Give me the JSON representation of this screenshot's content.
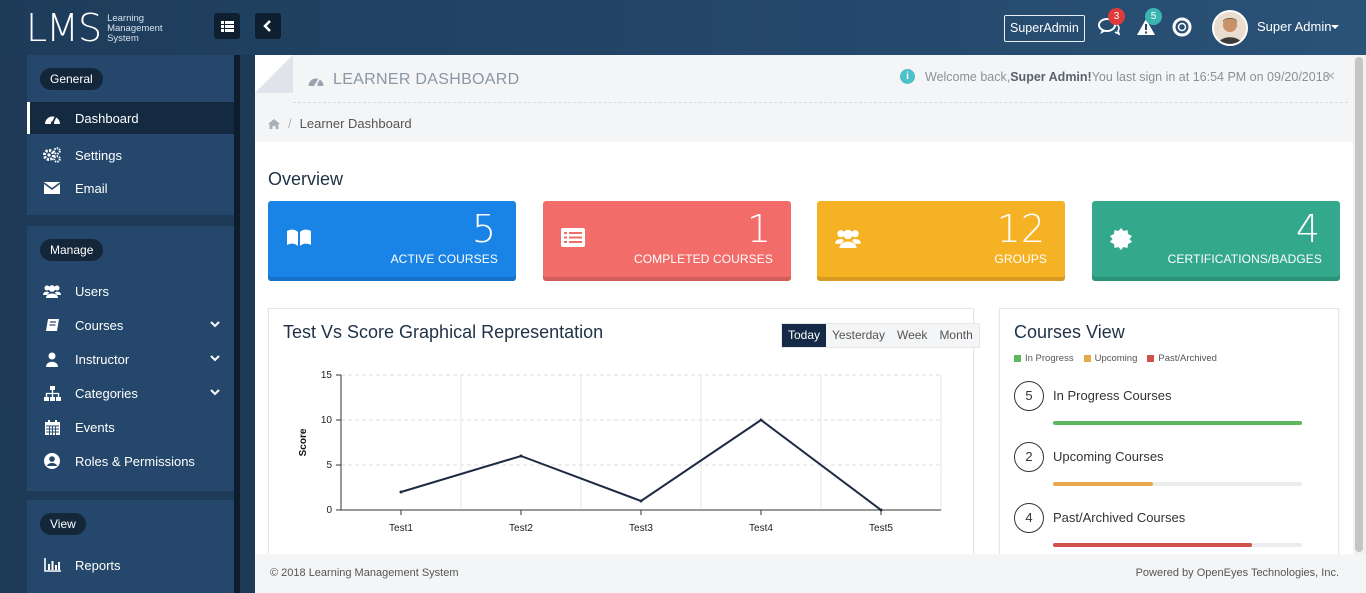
{
  "brand": {
    "logo": "LMS",
    "subtitle": [
      "Learning",
      "Management",
      "System"
    ]
  },
  "topbar": {
    "role": "SuperAdmin",
    "messages_count": "3",
    "alerts_count": "5",
    "user_name": "Super Admin",
    "icons": [
      "menu-icon",
      "chevron-left-icon",
      "chat-icon",
      "warning-icon",
      "lifebuoy-icon"
    ]
  },
  "sidebar": {
    "groups": [
      {
        "label": "General",
        "items": [
          {
            "label": "Dashboard",
            "icon": "dashboard-icon",
            "active": true
          },
          {
            "label": "Settings",
            "icon": "cogs-icon"
          },
          {
            "label": "Email",
            "icon": "envelope-icon"
          }
        ]
      },
      {
        "label": "Manage",
        "items": [
          {
            "label": "Users",
            "icon": "users-icon"
          },
          {
            "label": "Courses",
            "icon": "book-icon",
            "expandable": true
          },
          {
            "label": "Instructor",
            "icon": "user-icon",
            "expandable": true
          },
          {
            "label": "Categories",
            "icon": "sitemap-icon",
            "expandable": true
          },
          {
            "label": "Events",
            "icon": "calendar-icon"
          },
          {
            "label": "Roles & Permissions",
            "icon": "user-circle-icon"
          }
        ]
      },
      {
        "label": "View",
        "items": [
          {
            "label": "Reports",
            "icon": "bar-chart-icon"
          }
        ]
      }
    ]
  },
  "header": {
    "title": "LEARNER DASHBOARD",
    "welcome_prefix": "Welcome back,",
    "welcome_user": "Super Admin!",
    "welcome_suffix": "You last sign in at 16:54 PM on 09/20/2018",
    "close": "×"
  },
  "breadcrumb": {
    "sep": "/",
    "current": "Learner Dashboard"
  },
  "overview": {
    "title": "Overview",
    "cards": [
      {
        "value": "5",
        "label": "ACTIVE COURSES",
        "icon": "open-book-icon",
        "color": "#1a84e6"
      },
      {
        "value": "1",
        "label": "COMPLETED COURSES",
        "icon": "list-alt-icon",
        "color": "#f26d6a"
      },
      {
        "value": "12",
        "label": "GROUPS",
        "icon": "users-icon",
        "color": "#f6b225"
      },
      {
        "value": "4",
        "label": "CERTIFICATIONS/BADGES",
        "icon": "certificate-icon",
        "color": "#33a88c"
      }
    ]
  },
  "test_panel": {
    "title": "Test Vs Score Graphical Representation",
    "ranges": [
      "Today",
      "Yesterday",
      "Week",
      "Month"
    ],
    "active_range": "Today"
  },
  "chart_data": {
    "type": "line",
    "categories": [
      "Test1",
      "Test2",
      "Test3",
      "Test4",
      "Test5"
    ],
    "series": [
      {
        "values": [
          2,
          6,
          1,
          10,
          0
        ]
      }
    ],
    "ylabel": "Score",
    "xlabel": "",
    "ylim": [
      0,
      15
    ],
    "yticks": [
      0,
      5,
      10,
      15
    ],
    "grid": true,
    "line_color": "#1e2a44"
  },
  "courses_view": {
    "title": "Courses View",
    "legend": [
      {
        "label": "In Progress",
        "color": "#5cb85c"
      },
      {
        "label": "Upcoming",
        "color": "#e8a94c"
      },
      {
        "label": "Past/Archived",
        "color": "#d0524a"
      }
    ],
    "rows": [
      {
        "count": "5",
        "label": "In Progress Courses",
        "progress": 100,
        "color": "#5cb85c"
      },
      {
        "count": "2",
        "label": "Upcoming Courses",
        "progress": 40,
        "color": "#e8a94c"
      },
      {
        "count": "4",
        "label": "Past/Archived Courses",
        "progress": 80,
        "color": "#d0524a"
      }
    ]
  },
  "footer": {
    "copyright": "© 2018 Learning Management System",
    "powered": "Powered by OpenEyes Technologies, Inc."
  }
}
